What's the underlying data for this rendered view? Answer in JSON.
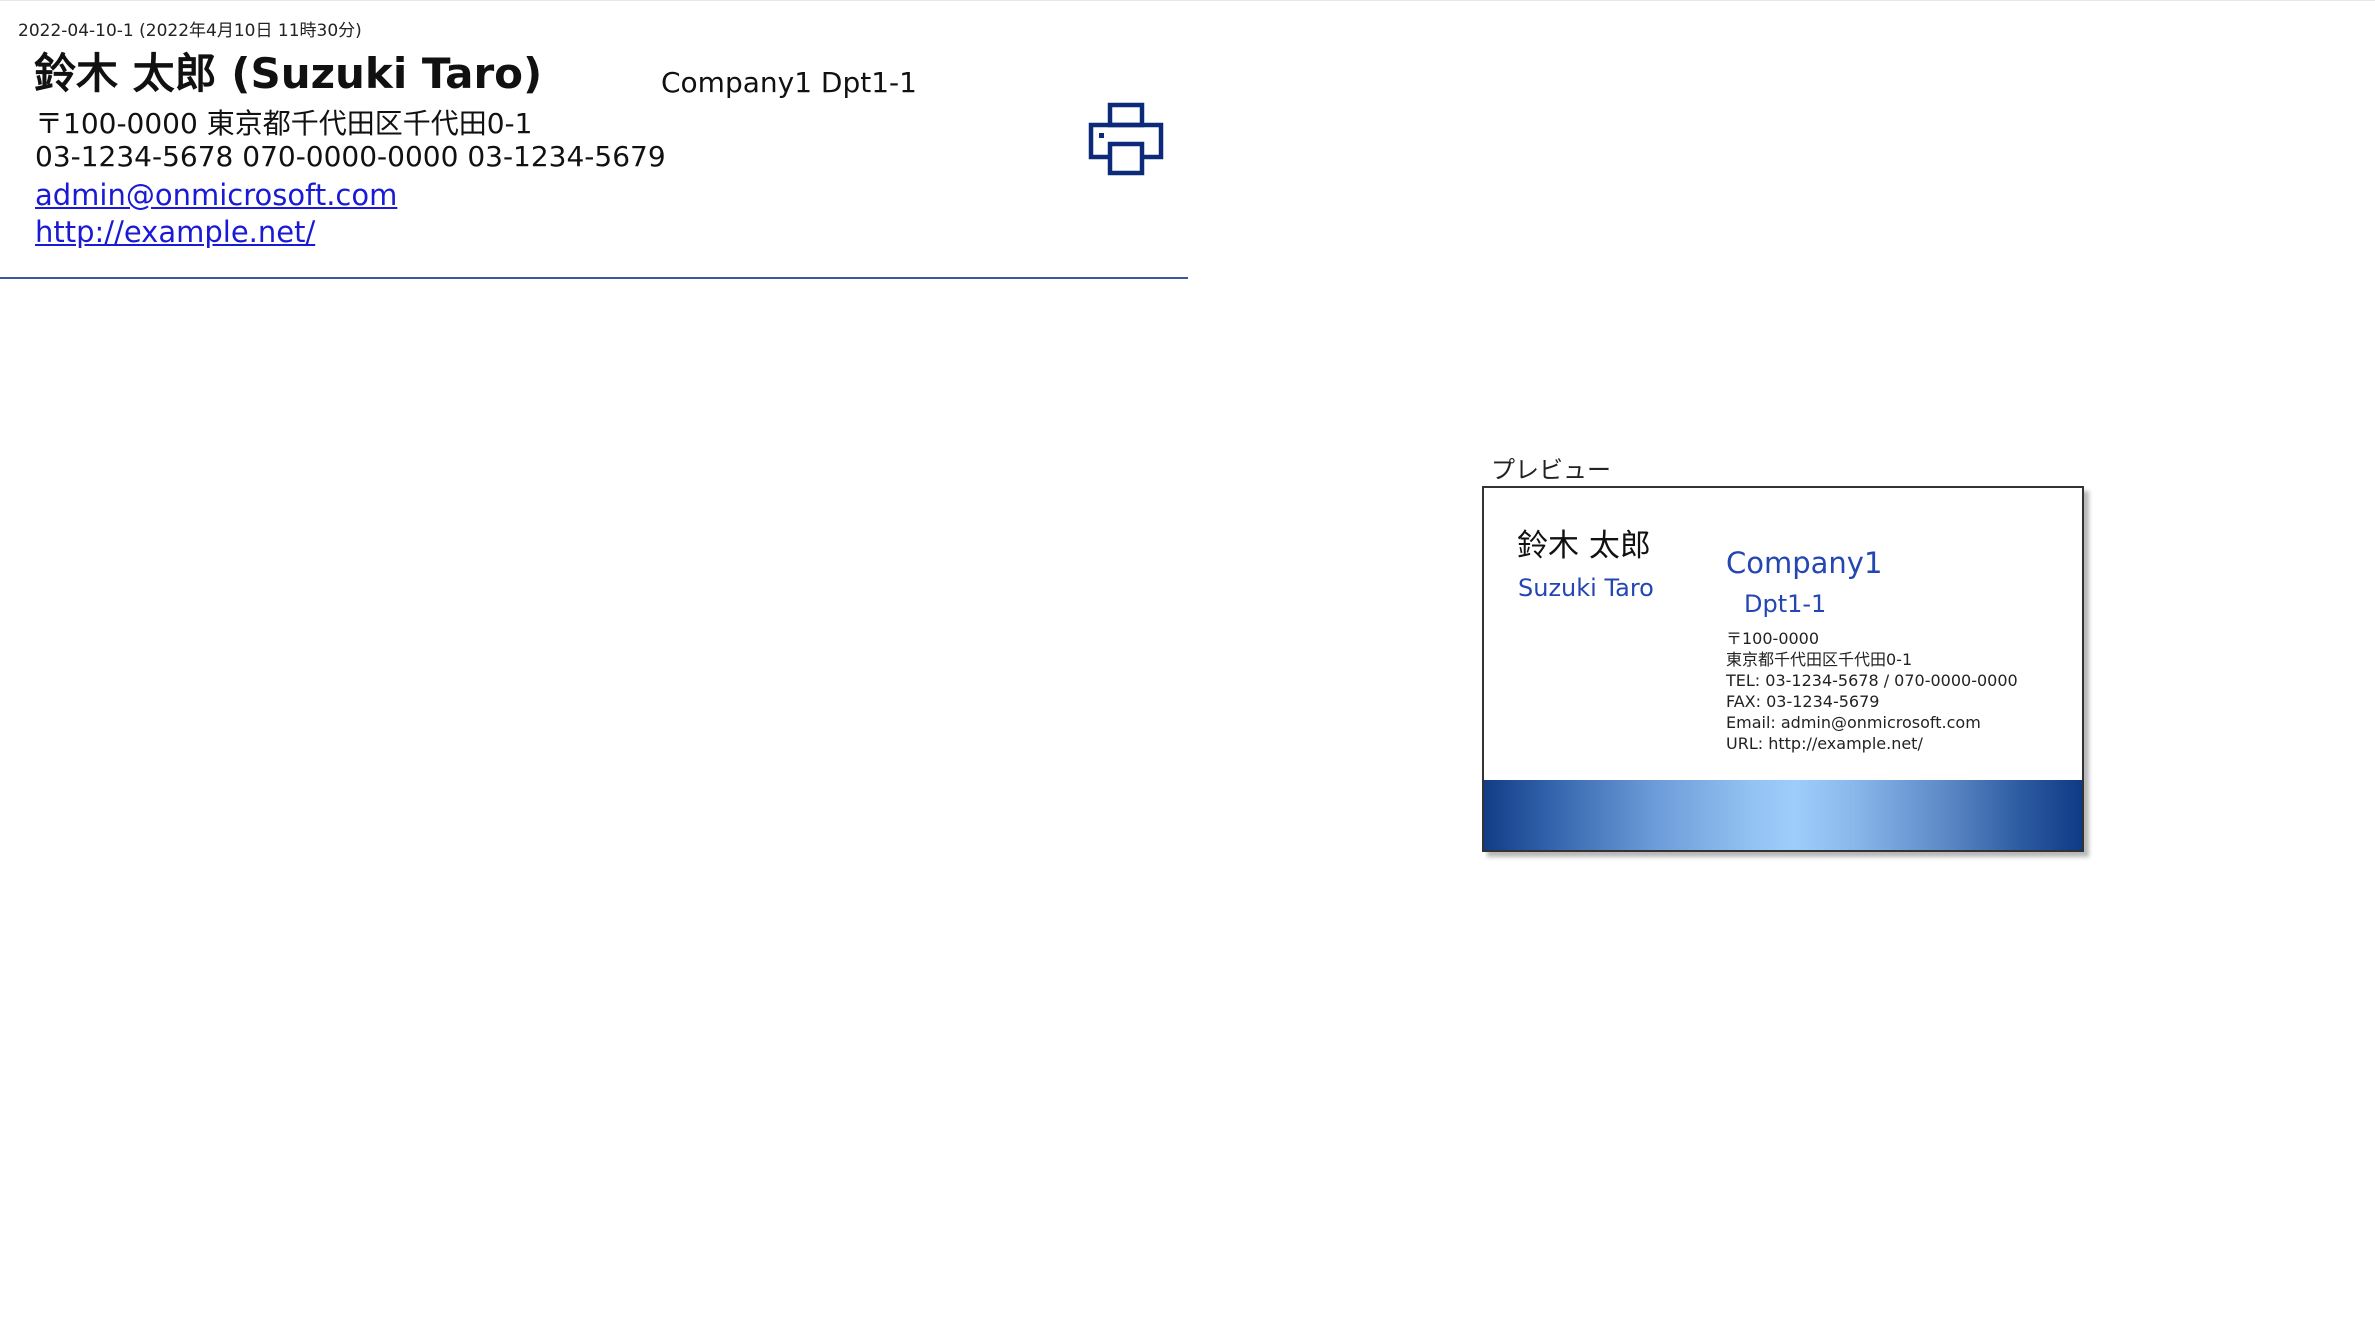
{
  "record": {
    "timestamp": "2022-04-10-1 (2022年4月10日 11時30分)",
    "name": "鈴木 太郎 (Suzuki Taro)",
    "address": "〒100-0000 東京都千代田区千代田0-1",
    "phones": "03-1234-5678 070-0000-0000 03-1234-5679",
    "email": "admin@onmicrosoft.com",
    "url": "http://example.net/",
    "company": "Company1 Dpt1-1",
    "print_icon": "printer-icon"
  },
  "preview": {
    "label": "プレビュー",
    "card": {
      "name_ja": "鈴木 太郎",
      "name_en": "Suzuki Taro",
      "company": "Company1",
      "department": "Dpt1-1",
      "postal": "〒100-0000",
      "address": "東京都千代田区千代田0-1",
      "tel": "TEL: 03-1234-5678 / 070-0000-0000",
      "fax": "FAX: 03-1234-5679",
      "email": "Email: admin@onmicrosoft.com",
      "url": "URL: http://example.net/"
    }
  },
  "colors": {
    "accent_blue": "#2346b2",
    "link_blue": "#1a1ad6",
    "icon_navy": "#0d2a7a",
    "divider": "#3b5a9e"
  }
}
